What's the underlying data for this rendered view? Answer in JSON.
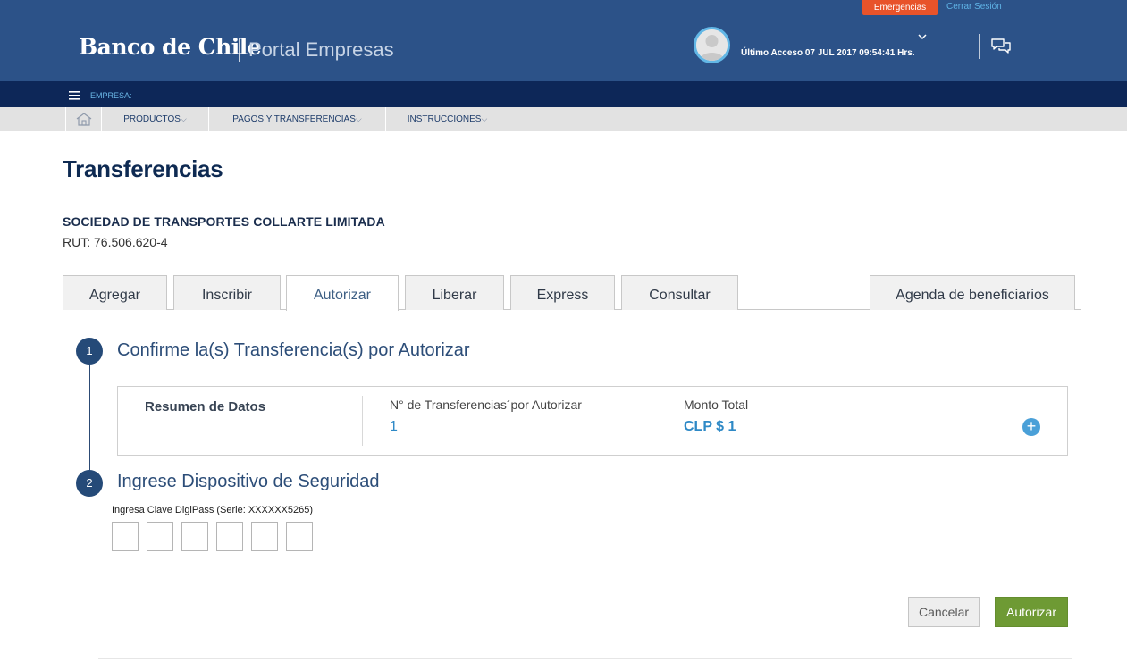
{
  "header": {
    "emergency_label": "Emergencias",
    "logout_label": "Cerrar Sesión",
    "logo_text": "Banco de Chile",
    "portal_title": "Portal Empresas",
    "last_access": "Último Acceso 07 JUL 2017 09:54:41 Hrs.",
    "icons": [
      "avatar-icon",
      "chevron-down-icon",
      "chat-icon"
    ],
    "colors": {
      "bar": "#2c5288",
      "emergency": "#e8532a",
      "link": "#5fb3e6"
    }
  },
  "empresa_bar": {
    "label": "EMPRESA:",
    "icon": "hamburger-icon",
    "color": "#0d2758"
  },
  "nav": {
    "home_icon": "home-icon",
    "items": [
      {
        "label": "PRODUCTOS",
        "caret": "⌵"
      },
      {
        "label": "PAGOS Y TRANSFERENCIAS",
        "caret": "⌵"
      },
      {
        "label": "INSTRUCCIONES",
        "caret": "⌵"
      }
    ]
  },
  "page": {
    "title": "Transferencias",
    "company": "SOCIEDAD DE TRANSPORTES COLLARTE LIMITADA",
    "rut": "RUT: 76.506.620-4"
  },
  "tabs": [
    {
      "label": "Agregar",
      "active": false
    },
    {
      "label": "Inscribir",
      "active": false
    },
    {
      "label": "Autorizar",
      "active": true
    },
    {
      "label": "Liberar",
      "active": false
    },
    {
      "label": "Express",
      "active": false
    },
    {
      "label": "Consultar",
      "active": false
    },
    {
      "label": "Agenda de beneficiarios",
      "active": false
    }
  ],
  "steps": [
    {
      "number": "1",
      "title": "Confirme la(s) Transferencia(s) por Autorizar"
    },
    {
      "number": "2",
      "title": "Ingrese Dispositivo de Seguridad"
    }
  ],
  "summary": {
    "heading": "Resumen de Datos",
    "count_label": "N° de Transferencias´por Autorizar",
    "count_value": "1",
    "amount_label": "Monto Total",
    "amount_value": "CLP $ 1",
    "expand_symbol": "+",
    "expand_icon": "plus-circle-icon"
  },
  "security": {
    "label": "Ingresa Clave DigiPass (Serie: XXXXXX5265)",
    "digits": [
      "",
      "",
      "",
      "",
      "",
      ""
    ]
  },
  "actions": {
    "cancel_label": "Cancelar",
    "authorize_label": "Autorizar",
    "colors": {
      "authorize": "#6e9a34"
    }
  }
}
